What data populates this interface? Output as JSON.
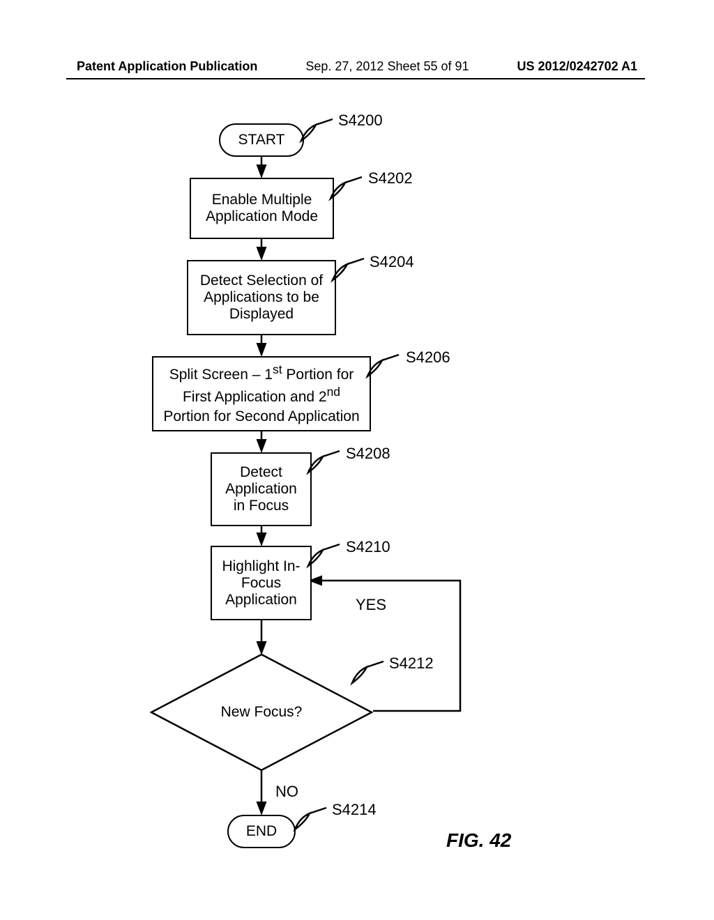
{
  "header": {
    "left": "Patent Application Publication",
    "center": "Sep. 27, 2012  Sheet 55 of 91",
    "right": "US 2012/0242702 A1"
  },
  "nodes": {
    "start": "START",
    "s4202": "Enable Multiple Application Mode",
    "s4204": "Detect Selection of Applications to be Displayed",
    "s4206_line1": "Split Screen – 1",
    "s4206_sup1": "st",
    "s4206_line1b": " Portion for",
    "s4206_line2a": "First Application and 2",
    "s4206_sup2": "nd",
    "s4206_line3": "Portion for Second Application",
    "s4208": "Detect Application in Focus",
    "s4210": "Highlight In-Focus Application",
    "s4212": "New Focus?",
    "end": "END"
  },
  "step_labels": {
    "s4200": "S4200",
    "s4202": "S4202",
    "s4204": "S4204",
    "s4206": "S4206",
    "s4208": "S4208",
    "s4210": "S4210",
    "s4212": "S4212",
    "s4214": "S4214"
  },
  "branches": {
    "yes": "YES",
    "no": "NO"
  },
  "figure": "FIG. 42"
}
